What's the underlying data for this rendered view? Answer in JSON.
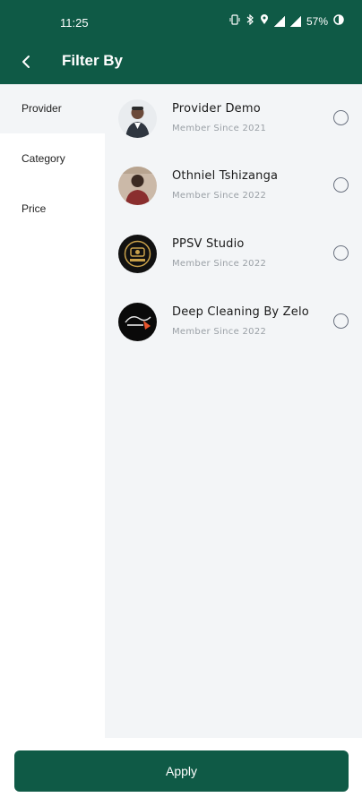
{
  "status": {
    "time": "11:25",
    "battery": "57%",
    "icons": [
      "vibrate-icon",
      "bluetooth-icon",
      "location-icon",
      "wifi-icon",
      "signal-icon",
      "battery-icon"
    ]
  },
  "header": {
    "title": "Filter By",
    "back_icon": "back-arrow-icon"
  },
  "sidebar": {
    "items": [
      {
        "label": "Provider",
        "active": true
      },
      {
        "label": "Category",
        "active": false
      },
      {
        "label": "Price",
        "active": false
      }
    ]
  },
  "providers": [
    {
      "name": "Provider Demo",
      "since": "Member Since 2021",
      "selected": false
    },
    {
      "name": "Othniel Tshizanga",
      "since": "Member Since 2022",
      "selected": false
    },
    {
      "name": "PPSV Studio",
      "since": "Member Since 2022",
      "selected": false
    },
    {
      "name": "Deep Cleaning By Zelo",
      "since": "Member Since 2022",
      "selected": false
    }
  ],
  "footer": {
    "apply_label": "Apply"
  },
  "colors": {
    "primary": "#0f5a46",
    "panel_bg": "#f3f5f7"
  }
}
